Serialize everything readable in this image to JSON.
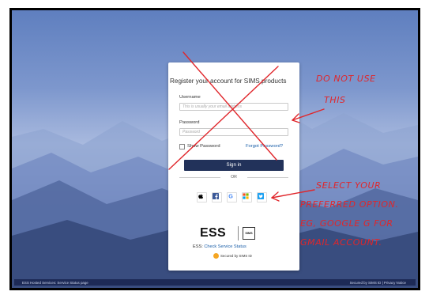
{
  "login": {
    "title": "Register your account for SIMS products",
    "username_label": "Username",
    "username_placeholder": "This is usually your email address",
    "password_label": "Password",
    "password_placeholder": "Password",
    "show_password": "Show Password",
    "forgot_password": "Forgot Password?",
    "signin": "Sign in",
    "or": "OR"
  },
  "social_icons": [
    "apple-icon",
    "facebook-icon",
    "google-icon",
    "microsoft-icon",
    "twitter-icon"
  ],
  "branding": {
    "ess": "ESS",
    "sims": "SIMS",
    "status_prefix": "ESS:",
    "status_link": "Check Service Status",
    "secured": "Secured by SIMS ID"
  },
  "footer": {
    "left": "ESS Hosted Services: Service Status page",
    "right": "Secured by SIMS ID  |  Privacy Notice"
  },
  "annotation": {
    "line1": "DO NOT USE",
    "line2": "THIS",
    "line3": "SELECT YOUR",
    "line4": "PREFERRED OPTION.",
    "line5": "EG, GOOGLE G FOR",
    "line6": "GMAIL ACCOUNT.",
    "color": "#e0262b"
  }
}
